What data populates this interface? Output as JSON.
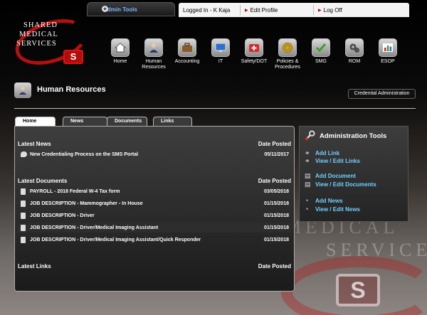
{
  "topbar": {
    "admin_tools": "Admin Tools",
    "logged_in": "Logged In - K Kaja",
    "edit_profile": "Edit Profile",
    "log_off": "Log Off"
  },
  "logo": {
    "line1": "SHARED",
    "line2": "MEDICAL",
    "line3": "SERVICES",
    "mark": "S"
  },
  "nav": [
    {
      "label": "Home",
      "icon": "home-icon"
    },
    {
      "label": "Human Resources",
      "icon": "hr-icon"
    },
    {
      "label": "Accounting",
      "icon": "briefcase-icon"
    },
    {
      "label": "IT",
      "icon": "monitor-icon"
    },
    {
      "label": "Safety/DOT",
      "icon": "first-aid-icon"
    },
    {
      "label": "Policies & Procedures",
      "icon": "seal-icon"
    },
    {
      "label": "SMG",
      "icon": "checkmark-icon"
    },
    {
      "label": "ROM",
      "icon": "gears-icon"
    },
    {
      "label": "ESOP",
      "icon": "chart-icon"
    }
  ],
  "page": {
    "title": "Human Resources",
    "credential_button": "Credential Administration"
  },
  "tabs": [
    "Home",
    "News",
    "Documents",
    "Links"
  ],
  "news": {
    "heading": "Latest News",
    "date_heading": "Date Posted",
    "items": [
      {
        "title": "New Credentialing Process on the SMS Portal",
        "date": "05/11/2017"
      }
    ]
  },
  "documents": {
    "heading": "Latest Documents",
    "date_heading": "Date Posted",
    "items": [
      {
        "title": "PAYROLL - 2018 Federal W-4 Tax form",
        "date": "03/05/2018"
      },
      {
        "title": "JOB DESCRIPTION - Mammographer - In House",
        "date": "01/15/2018"
      },
      {
        "title": "JOB DESCRIPTION - Driver",
        "date": "01/15/2018"
      },
      {
        "title": "JOB DESCRIPTION - Driver/Medical Imaging Assistant",
        "date": "01/15/2018"
      },
      {
        "title": "JOB DESCRIPTION - Driver/Medical Imaging Assistant/Quick Responder",
        "date": "01/15/2018"
      }
    ]
  },
  "links": {
    "heading": "Latest Links",
    "date_heading": "Date Posted"
  },
  "admin": {
    "title": "Administration Tools",
    "add_link": "Add Link",
    "edit_links": "View / Edit Links",
    "add_document": "Add Document",
    "edit_documents": "View / Edit Documents",
    "add_news": "Add News",
    "edit_news": "View / Edit News"
  },
  "watermark": {
    "line1": "MEDICAL",
    "line2": "SERVICES",
    "mark": "S"
  },
  "colors": {
    "accent_link": "#6fd0ff",
    "brand_red": "#b50f0f"
  }
}
